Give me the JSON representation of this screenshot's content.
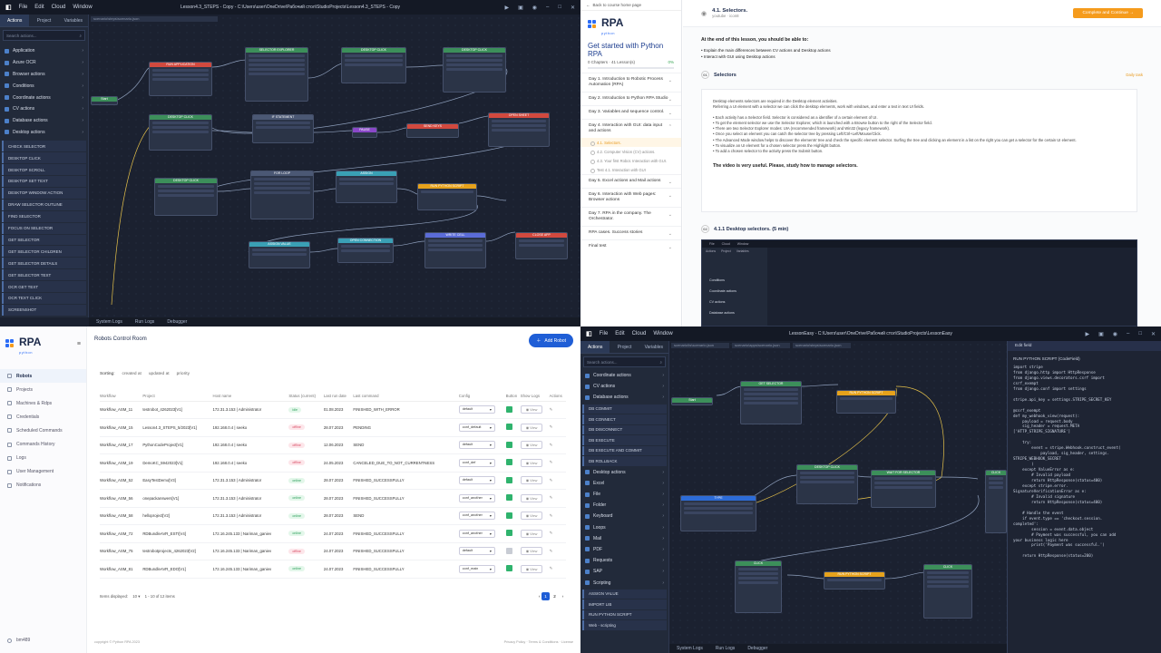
{
  "q1": {
    "menu": [
      "File",
      "Edit",
      "Cloud",
      "Window"
    ],
    "title": "Lesson4.3_STEPS - Copy - C:\\Users\\user\\OneDrive\\Рабочий стол\\StudioProjects\\Lesson4.3_STEPS - Copy",
    "tabs": [
      "Actions",
      "Project",
      "Variables"
    ],
    "search_placeholder": "Search actions...",
    "path": "scenario\\steps\\scenario.json",
    "categories": [
      "Application",
      "Azure OCR",
      "Browser actions",
      "Conditions",
      "Coordinate actions",
      "CV actions",
      "Database actions",
      "Desktop actions"
    ],
    "actions": [
      "CHECK SELECTOR",
      "DESKTOP CLICK",
      "DESKTOP SCROLL",
      "DESKTOP SET TEXT",
      "DESKTOP WINDOW ACTION",
      "DRAW SELECTOR OUTLINE",
      "FIND SELECTOR",
      "FOCUS ON SELECTOR",
      "GET SELECTOR",
      "GET SELECTOR CHILDREN",
      "GET SELECTOR DETAILS",
      "GET SELECTOR TEXT",
      "OCR GET TEXT",
      "OCR TEXT CLICK",
      "SCREENSHOT"
    ],
    "bottom_tabs": [
      "System Logs",
      "Run Logs",
      "Debugger"
    ]
  },
  "q2": {
    "back": "Back to course home page",
    "logo": "RPA",
    "logo_sub": "python",
    "course_title": "Get started with Python RPA",
    "progress_left": "0 Chapters  ·  41 Lesson(s)",
    "progress_pct": "0%",
    "progress_value": 0,
    "days": [
      {
        "label": "Day 1. Introduction to Robotic Process Automation (RPA)"
      },
      {
        "label": "Day 2. Introduction to Python RPA Studio"
      },
      {
        "label": "Day 3. Variables and sequence control."
      },
      {
        "label": "Day 4. Interaction with GUI: data input and actions"
      }
    ],
    "lessons": [
      "4.1. Selectors.",
      "4.2. Computer Vision (CV) actions.",
      "4.3. Your first Robot. Interaction with GUI.",
      "Test 4.1. Interaction with GUI"
    ],
    "days2": [
      "Day 5. Excel actions and Mail actions",
      "Day 6. Interaction with Web pages: Browser actions",
      "Day 7. RPA in the company. The Orchestrator.",
      "RPA cases. Success stories",
      "Final test"
    ],
    "lesson_title": "4.1. Selectors.",
    "lesson_sub": "youtube · icon8",
    "complete_btn": "Complete and Continue →",
    "intro": "At the end of this lesson, you should be able to:",
    "goals": [
      "Explain the main differences between CV actions and Desktop actions",
      "Interact with GUI using Desktop actions"
    ],
    "section_num": "01",
    "section_title": "Selectors",
    "daily": "Daily task",
    "body1": "Desktop elements selectors are required in the Desktop element activities.",
    "body2": "Referring a UI element with a selector we can click the desktop elements, work with windows, and enter a text in text UI fields.",
    "bullets": [
      "Each activity has a Selector field. Selector is considered as a identifier of a certain element of UI.",
      "To get the element selector we use the Selector Explorer, which is launched with a Browse button to the right of the Selector field.",
      "There are two Selector Explorer modes: UIA (recommended framework) and Win32 (legacy framework).",
      "Once you select an element you can catch the selector tree by pressing Left/Ctrl+Left/Mouse/Click.",
      "The Advanced Mode window helps to discover the elements' tree and check the specific element selector. Surfing the tree and clicking an element in a list on the right you can get a selector for the certain UI element.",
      "To visualize an UI element for a chosen selector press the Highlight button.",
      "To add a chosen selector to the activity press the Submit button."
    ],
    "emph": "The video is very useful. Please, study how to manage selectors.",
    "video_num": "02",
    "video_title": "4.1.1 Desktop selectors. (5 min)",
    "video_menu": [
      "File",
      "Cloud",
      "Window"
    ],
    "video_tabs": [
      "Actions",
      "Project",
      "Variables"
    ],
    "video_items": [
      "Conditions",
      "Coordinate actions",
      "CV actions",
      "Database actions"
    ]
  },
  "q3": {
    "logo": "RPA",
    "logo_sub": "python",
    "nav": [
      "Robots",
      "Projects",
      "Machines & Rdps",
      "Credentials",
      "Scheduled Commands",
      "Commands History",
      "Logs",
      "User Management",
      "Notifications"
    ],
    "user": "bm489",
    "title": "Robots Control Room",
    "add_btn": "Add Robot",
    "sorting_label": "Sorting:",
    "sorting": [
      "created at",
      "updated at",
      "priority"
    ],
    "headers": [
      "Workflow",
      "Project",
      "Host name",
      "Status (current)",
      "Last run date",
      "Last command",
      "Config",
      "Button",
      "Show Logs",
      "Actions"
    ],
    "rows": [
      {
        "workflow": "Workflow_ASM_11",
        "project": "testrobot_4262023[V1]",
        "host": "172.31.3.153 | Administrator",
        "status": "idle",
        "date": "01.08.2023",
        "command": "FINISHED_WITH_ERROR",
        "config": "default"
      },
      {
        "workflow": "Workflow_ASM_15",
        "project": "Lesson4.3_STEPS_5/2023[V1]",
        "host": "192.168.0.4 | seeko",
        "status": "offline",
        "date": "28.07.2023",
        "command": "PENDING",
        "config": "conf_default"
      },
      {
        "workflow": "Workflow_ASM_17",
        "project": "PythonCodeProject[V1]",
        "host": "192.168.0.4 | seeko",
        "status": "offline",
        "date": "12.06.2023",
        "command": "SEND",
        "config": "default"
      },
      {
        "workflow": "Workflow_ASM_19",
        "project": "DemoKC_5942023[V1]",
        "host": "192.168.0.4 | seeko",
        "status": "offline",
        "date": "24.05.2023",
        "command": "CANCELED_DUE_TO_NOT_CURRENTNESS",
        "config": "conf_def"
      },
      {
        "workflow": "Workflow_ASM_52",
        "project": "EasyTestDemo[V3]",
        "host": "172.31.3.153 | Administrator",
        "status": "online",
        "date": "28.07.2023",
        "command": "FINISHED_SUCCESSFULLY",
        "config": "default"
      },
      {
        "workflow": "Workflow_ASM_56",
        "project": "onepackanswers[V1]",
        "host": "172.31.3.153 | Administrator",
        "status": "online",
        "date": "28.07.2023",
        "command": "FINISHED_SUCCESSFULLY",
        "config": "conf_another"
      },
      {
        "workflow": "Workflow_ASM_58",
        "project": "helloproject[V2]",
        "host": "172.31.3.153 | Administrator",
        "status": "online",
        "date": "28.07.2023",
        "command": "SEND",
        "config": "conf_another"
      },
      {
        "workflow": "Workflow_ASM_72",
        "project": "RDBundleAVR_ESTI[V4]",
        "host": "172.16.245.133 | Nariman_ganiev",
        "status": "online",
        "date": "24.07.2023",
        "command": "FINISHED_SUCCESSFULLY",
        "config": "conf_another"
      },
      {
        "workflow": "Workflow_ASM_75",
        "project": "testrobotprojects_4262023[V2]",
        "host": "172.16.245.133 | Nariman_ganiev",
        "status": "offline",
        "date": "24.07.2023",
        "command": "FINISHED_SUCCESSFULLY",
        "config": "default"
      },
      {
        "workflow": "Workflow_ASM_81",
        "project": "RDBundleAVR_EDO[V1]",
        "host": "172.16.245.133 | Nariman_ganiev",
        "status": "online",
        "date": "24.07.2023",
        "command": "FINISHED_SUCCESSFULLY",
        "config": "conf_main"
      }
    ],
    "view_label": "View",
    "items_label": "Items displayed:",
    "per_page": "10",
    "range": "1 - 10 of 12 items",
    "pages": [
      "1",
      "2"
    ],
    "footer_left": "copyright © Python RPA 2023",
    "footer_right": "Privacy Policy · Terms & Conditions · License"
  },
  "q4": {
    "menu": [
      "File",
      "Edit",
      "Cloud",
      "Window"
    ],
    "title": "LessonEasy - C:\\Users\\user\\OneDrive\\Рабочий стол\\StudioProjects\\LessonEasy",
    "tabs": [
      "Actions",
      "Project",
      "Variables"
    ],
    "search_placeholder": "Search actions...",
    "file_tabs": [
      "scenario\\ts\\scenario.json",
      "scenario\\apps\\scenario.json",
      "scenario\\steps\\scenario.json"
    ],
    "categories": [
      "Coordinate actions",
      "CV actions",
      "Database actions"
    ],
    "db_actions": [
      "DB COMMIT",
      "DB CONNECT",
      "DB DISCONNECT",
      "DB EXECUTE",
      "DB EXECUTE AND COMMIT",
      "DB ROLLBACK"
    ],
    "categories2": [
      "Desktop actions",
      "Excel",
      "File",
      "Folder",
      "Keyboard",
      "Loops",
      "Mail",
      "PDF",
      "Requests",
      "SAP",
      "Scripting"
    ],
    "script_actions": [
      "ASSIGN VALUE",
      "IMPORT LIB",
      "RUN PYTHON SCRIPT",
      "Web - scripting"
    ],
    "panel_tab": "Edit field",
    "panel_label": "RUN PYTHON SCRIPT (CodeField)",
    "code": "import stripe\nfrom django.http import HttpResponse\nfrom django.views.decorators.csrf import\ncsrf_exempt\nfrom django.conf import settings\n\nstripe.api_key = settings.STRIPE_SECRET_KEY\n\n@csrf_exempt\ndef my_webhook_view(request):\n    payload = request.body\n    sig_header = request.META\n['HTTP_STRIPE_SIGNATURE']\n\n    try:\n        event = stripe.Webhook.construct_event(\n            payload, sig_header, settings.\nSTRIPE_WEBHOOK_SECRET\n        )\n    except ValueError as e:\n        # Invalid payload\n        return HttpResponse(status=400)\n    except stripe.error.\nSignatureVerificationError as e:\n        # Invalid signature\n        return HttpResponse(status=400)\n\n    # Handle the event\n    if event.type == 'checkout.session.\ncompleted':\n        session = event.data.object\n        # Payment was successful, you can add\nyour business logic here\n        print('Payment was successful.')\n\n    return HttpResponse(status=200)",
    "bottom_tabs": [
      "System Logs",
      "Run Logs",
      "Debugger"
    ]
  },
  "colors": {
    "accent": "#1f5ed6",
    "orange": "#f59b1c",
    "green": "#2fb36d",
    "editor_bg": "#1b2130"
  }
}
